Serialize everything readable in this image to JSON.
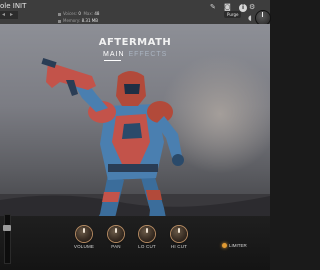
{
  "header": {
    "instrument_name": "ole INIT",
    "voice_label": "Voices:",
    "voice_value": "0",
    "max_label": "Max:",
    "max_value": "48",
    "memory_label": "Memory:",
    "memory_value": "8.31 MB",
    "purge_label": "Purge",
    "info_label": "i"
  },
  "brand": "AFTERMATH",
  "tabs": [
    {
      "label": "MAIN",
      "active": true
    },
    {
      "label": "EFFECTS",
      "active": false
    }
  ],
  "knobs": [
    {
      "label": "VOLUME"
    },
    {
      "label": "PAN"
    },
    {
      "label": "LO CUT"
    },
    {
      "label": "HI CUT"
    }
  ],
  "limiter": {
    "label": "LIMITER",
    "on": true
  },
  "colors": {
    "accent": "#e19a32",
    "knob_ring": "#b48a62",
    "armor_blue": "#4a7fb0",
    "armor_red": "#b24a3a"
  },
  "icons": [
    "tool-icon",
    "camera-icon",
    "speaker-icon",
    "info-icon",
    "settings-icon"
  ]
}
